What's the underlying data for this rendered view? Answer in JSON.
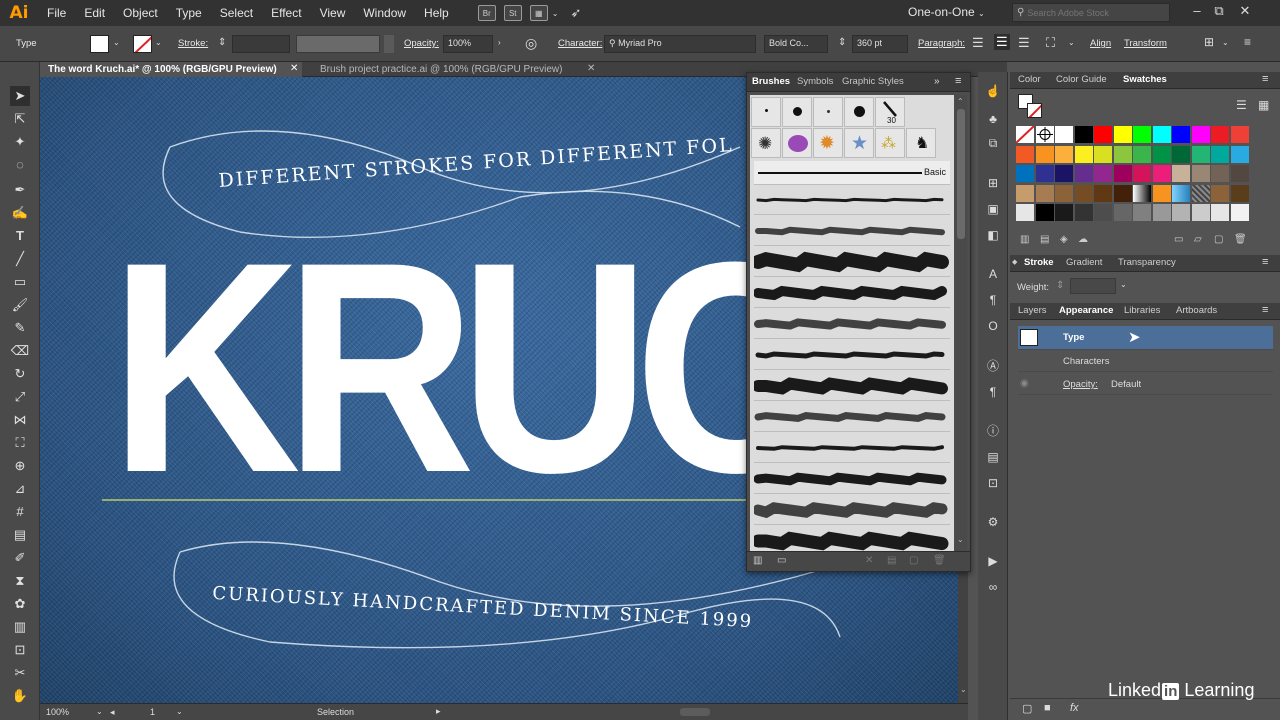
{
  "app": {
    "logo": "Ai",
    "workspace": "One-on-One",
    "search_placeholder": "Search Adobe Stock",
    "bridge_icon": "Br",
    "stock_icon": "St"
  },
  "menu": [
    "File",
    "Edit",
    "Object",
    "Type",
    "Select",
    "Effect",
    "View",
    "Window",
    "Help"
  ],
  "control": {
    "type_label": "Type",
    "stroke_label": "Stroke:",
    "opacity_label": "Opacity:",
    "opacity_value": "100%",
    "character_label": "Character:",
    "font_value": "Myriad Pro",
    "style_value": "Bold Co...",
    "size_value": "360 pt",
    "paragraph_label": "Paragraph:",
    "align_label": "Align",
    "transform_label": "Transform"
  },
  "tabs": [
    {
      "label": "The word Kruch.ai* @ 100% (RGB/GPU Preview)",
      "active": true
    },
    {
      "label": "Brush project practice.ai @ 100% (RGB/GPU Preview)",
      "active": false
    }
  ],
  "artwork": {
    "top_text": "DIFFERENT STROKES FOR DIFFERENT FOL",
    "big_word": "KRUC",
    "bottom_text": "CURIOUSLY HANDCRAFTED DENIM SINCE 1999",
    "colors": {
      "denim": "#2f5a8a",
      "letters": "#ffffff",
      "baseline": "#d4e36b"
    }
  },
  "brushes": {
    "tabs": [
      "Brushes",
      "Symbols",
      "Graphic Styles"
    ],
    "size_label": "30",
    "basic_label": "Basic"
  },
  "right": {
    "top_tabs": [
      "Color",
      "Color Guide",
      "Swatches"
    ],
    "stroke_tabs": [
      "Stroke",
      "Gradient",
      "Transparency"
    ],
    "weight_label": "Weight:",
    "appearance_tabs": [
      "Layers",
      "Appearance",
      "Libraries",
      "Artboards"
    ],
    "appearance_rows": {
      "type": "Type",
      "characters": "Characters",
      "opacity": "Opacity:",
      "opacity_value": "Default"
    }
  },
  "status": {
    "zoom": "100%",
    "artboard": "1",
    "mode": "Selection"
  },
  "watermark": {
    "brand": "Linked",
    "in": "in",
    "suffix": " Learning"
  }
}
